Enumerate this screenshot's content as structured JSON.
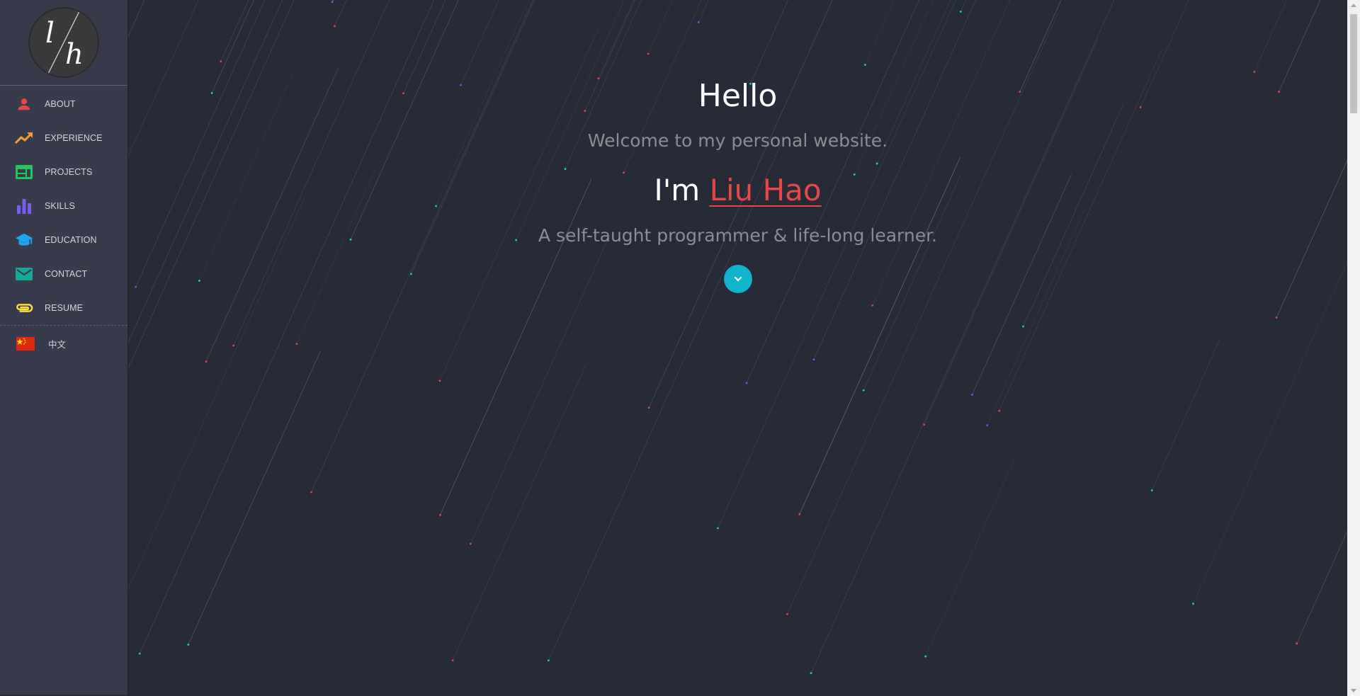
{
  "sidebar": {
    "logo_text": "l/h",
    "items": [
      {
        "label": "ABOUT",
        "icon": "person-icon",
        "color": "#e64848"
      },
      {
        "label": "EXPERIENCE",
        "icon": "trending-up-icon",
        "color": "#f0a030"
      },
      {
        "label": "PROJECTS",
        "icon": "web-icon",
        "color": "#22c55e"
      },
      {
        "label": "SKILLS",
        "icon": "bar-chart-icon",
        "color": "#7a5cf0"
      },
      {
        "label": "EDUCATION",
        "icon": "graduation-cap-icon",
        "color": "#1ea7f0"
      },
      {
        "label": "CONTACT",
        "icon": "mail-icon",
        "color": "#16a99a"
      },
      {
        "label": "RESUME",
        "icon": "paperclip-icon",
        "color": "#f5e23a"
      }
    ],
    "language": {
      "label": "中文",
      "icon": "china-flag-icon"
    }
  },
  "hero": {
    "greeting": "Hello",
    "welcome": "Welcome to my personal website.",
    "intro_prefix": "I'm ",
    "name": "Liu Hao",
    "tagline": "A self-taught programmer & life-long learner.",
    "scroll_button_icon": "chevron-down-icon"
  },
  "colors": {
    "background": "#262b37",
    "sidebar": "#373b4c",
    "accent_name": "#e64848",
    "scroll_button": "#12b3cc"
  }
}
